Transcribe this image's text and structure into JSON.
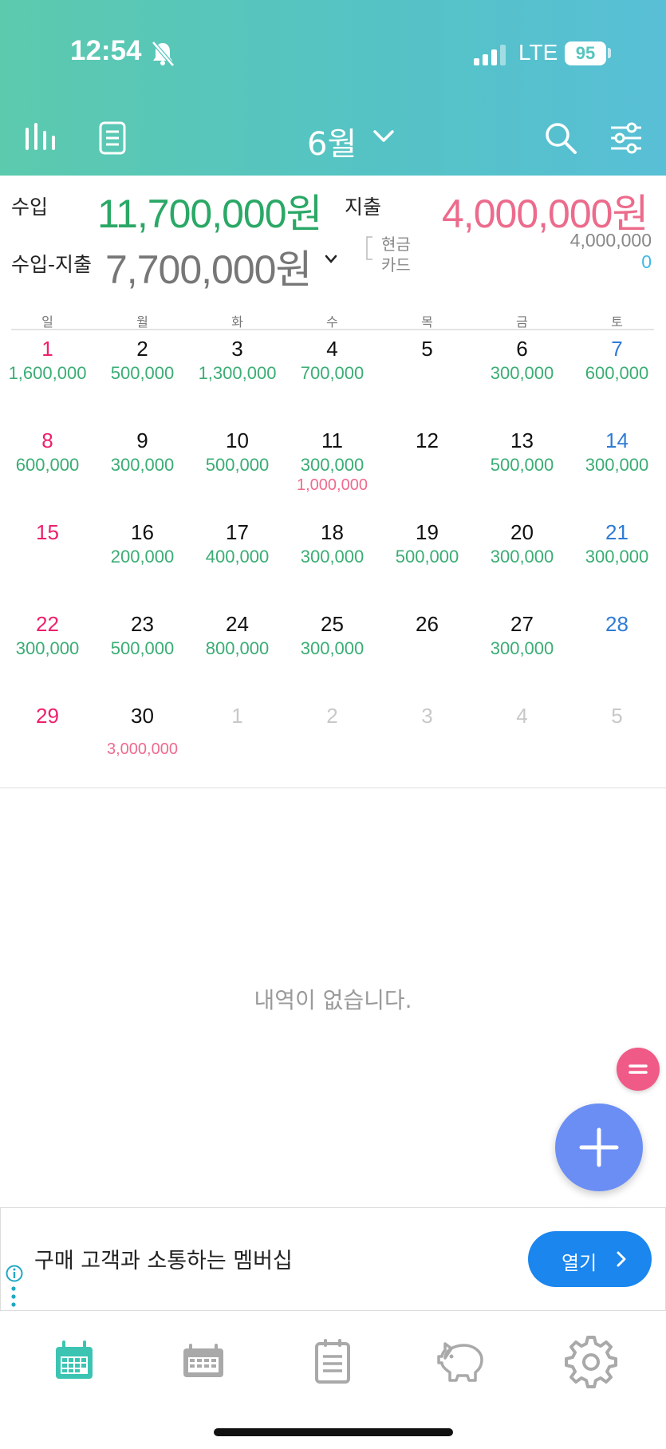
{
  "status_bar": {
    "time": "12:54",
    "network": "LTE",
    "battery": "95"
  },
  "header": {
    "month_title": "6월"
  },
  "summary": {
    "income_label": "수입",
    "income_amount": "11,700,000원",
    "expense_label": "지출",
    "expense_amount": "4,000,000원",
    "net_label": "수입-지출",
    "net_amount": "7,700,000원",
    "cash_label": "현금",
    "card_label": "카드",
    "cash_amount": "4,000,000",
    "card_amount": "0"
  },
  "weekdays": [
    "일",
    "월",
    "화",
    "수",
    "목",
    "금",
    "토"
  ],
  "calendar": {
    "week1": [
      {
        "day": "1",
        "income": "1,600,000",
        "expense": ""
      },
      {
        "day": "2",
        "income": "500,000",
        "expense": ""
      },
      {
        "day": "3",
        "income": "1,300,000",
        "expense": ""
      },
      {
        "day": "4",
        "income": "700,000",
        "expense": ""
      },
      {
        "day": "5",
        "income": "",
        "expense": ""
      },
      {
        "day": "6",
        "income": "300,000",
        "expense": ""
      },
      {
        "day": "7",
        "income": "600,000",
        "expense": ""
      }
    ],
    "week2": [
      {
        "day": "8",
        "income": "600,000",
        "expense": ""
      },
      {
        "day": "9",
        "income": "300,000",
        "expense": ""
      },
      {
        "day": "10",
        "income": "500,000",
        "expense": ""
      },
      {
        "day": "11",
        "income": "300,000",
        "expense": "1,000,000"
      },
      {
        "day": "12",
        "income": "",
        "expense": ""
      },
      {
        "day": "13",
        "income": "500,000",
        "expense": ""
      },
      {
        "day": "14",
        "income": "300,000",
        "expense": ""
      }
    ],
    "week3": [
      {
        "day": "15",
        "income": "",
        "expense": ""
      },
      {
        "day": "16",
        "income": "200,000",
        "expense": ""
      },
      {
        "day": "17",
        "income": "400,000",
        "expense": ""
      },
      {
        "day": "18",
        "income": "300,000",
        "expense": ""
      },
      {
        "day": "19",
        "income": "500,000",
        "expense": ""
      },
      {
        "day": "20",
        "income": "300,000",
        "expense": ""
      },
      {
        "day": "21",
        "income": "300,000",
        "expense": ""
      }
    ],
    "week4": [
      {
        "day": "22",
        "income": "300,000",
        "expense": ""
      },
      {
        "day": "23",
        "income": "500,000",
        "expense": ""
      },
      {
        "day": "24",
        "income": "800,000",
        "expense": ""
      },
      {
        "day": "25",
        "income": "300,000",
        "expense": ""
      },
      {
        "day": "26",
        "income": "",
        "expense": ""
      },
      {
        "day": "27",
        "income": "300,000",
        "expense": ""
      },
      {
        "day": "28",
        "income": "",
        "expense": ""
      }
    ],
    "week5": [
      {
        "day": "29",
        "income": "",
        "expense": ""
      },
      {
        "day": "30",
        "income": "",
        "expense": "3,000,000"
      },
      {
        "day": "1",
        "income": "",
        "expense": ""
      },
      {
        "day": "2",
        "income": "",
        "expense": ""
      },
      {
        "day": "3",
        "income": "",
        "expense": ""
      },
      {
        "day": "4",
        "income": "",
        "expense": ""
      },
      {
        "day": "5",
        "income": "",
        "expense": ""
      }
    ]
  },
  "empty_message": "내역이 없습니다.",
  "ad": {
    "text": "구매 고객과 소통하는 멤버십",
    "button_label": "열기"
  },
  "colors": {
    "income": "#3aad74",
    "expense": "#ee6b8e",
    "sunday": "#ee1f6c",
    "saturday": "#2f7bd6",
    "header_start": "#5ccaad",
    "header_end": "#58bfd6",
    "fab": "#6b8ef5",
    "fab_small": "#f05a87",
    "ad_button": "#1a86ee"
  },
  "icons": {
    "toolbar": [
      "stats-icon",
      "list-icon",
      "chevron-down-icon",
      "search-icon",
      "filter-icon"
    ],
    "tabbar": [
      "calendar-tab-icon",
      "calendar-outline-icon",
      "notepad-icon",
      "piggy-bank-icon",
      "settings-icon"
    ]
  }
}
